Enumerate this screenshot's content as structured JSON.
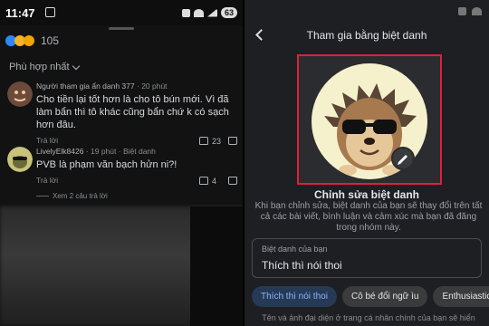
{
  "left": {
    "status_time": "11:47",
    "battery": "63",
    "reaction_count": "105",
    "filter_label": "Phù hợp nhất",
    "comments": [
      {
        "author": "Người tham gia ẩn danh 377",
        "time": "20 phút",
        "text": "Cho tiền lại tốt hơn là cho tô bún mới. Vì đã làm bẩn thì tô khác cũng bẩn chứ k có sạch hơn đâu.",
        "reply": "Trả lời",
        "votes": "23"
      },
      {
        "author": "LivelyElk8426",
        "time": "19 phút",
        "badge": "Biệt danh",
        "text": "PVB là phạm văn bạch hửn ni?!",
        "reply": "Trả lời",
        "votes": "4",
        "more_replies": "Xem 2 câu trả lời"
      }
    ]
  },
  "right": {
    "title": "Tham gia bằng biệt danh",
    "edit_title": "Chỉnh sửa biệt danh",
    "description": "Khi bạn chỉnh sửa, biệt danh của bạn sẽ thay đổi trên tất cả các bài viết, bình luận và cảm xúc mà bạn đã đăng trong nhóm này.",
    "field_label": "Biệt danh của bạn",
    "field_value": "Thích thì nói thoi",
    "chips": [
      "Thích thì nói thoi",
      "Cô bé đổi ngữ ìu",
      "EnthusiasticChe"
    ],
    "footer": "Tên và ảnh đại diện ở trang cá nhân chính của bạn sẽ hiển"
  },
  "colors": {
    "highlight_border": "#e0203a",
    "accent": "#2d88ff"
  }
}
